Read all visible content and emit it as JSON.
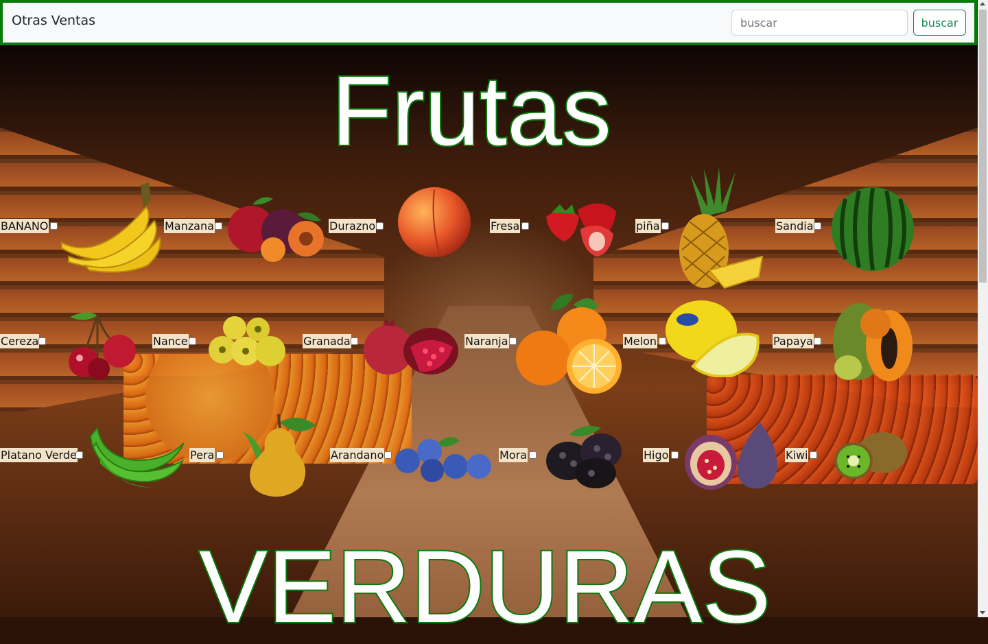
{
  "navbar": {
    "brand": "Otras Ventas",
    "search_placeholder": "buscar",
    "search_button": "buscar"
  },
  "headings": {
    "frutas": "Frutas",
    "verduras": "VERDURAS"
  },
  "colors": {
    "accent_green": "#0a7a0a",
    "button_green": "#198754"
  },
  "fruits": [
    {
      "label": "BANANO",
      "icon": "banana-icon"
    },
    {
      "label": "Manzana",
      "icon": "apple-icon"
    },
    {
      "label": "Durazno",
      "icon": "peach-icon"
    },
    {
      "label": "Fresa",
      "icon": "strawberry-icon"
    },
    {
      "label": "piña",
      "icon": "pineapple-icon"
    },
    {
      "label": "Sandia",
      "icon": "watermelon-icon"
    },
    {
      "label": "Cereza",
      "icon": "cherry-icon"
    },
    {
      "label": "Nance",
      "icon": "nance-icon"
    },
    {
      "label": "Granada",
      "icon": "pomegranate-icon"
    },
    {
      "label": "Naranja",
      "icon": "orange-icon"
    },
    {
      "label": "Melon",
      "icon": "melon-icon"
    },
    {
      "label": "Papaya",
      "icon": "papaya-icon"
    },
    {
      "label": "Platano Verde",
      "icon": "green-plantain-icon"
    },
    {
      "label": "Pera",
      "icon": "pear-icon"
    },
    {
      "label": "Arandano",
      "icon": "blueberry-icon"
    },
    {
      "label": "Mora",
      "icon": "blackberry-icon"
    },
    {
      "label": "Higo",
      "icon": "fig-icon"
    },
    {
      "label": "Kiwi",
      "icon": "kiwi-icon"
    }
  ]
}
